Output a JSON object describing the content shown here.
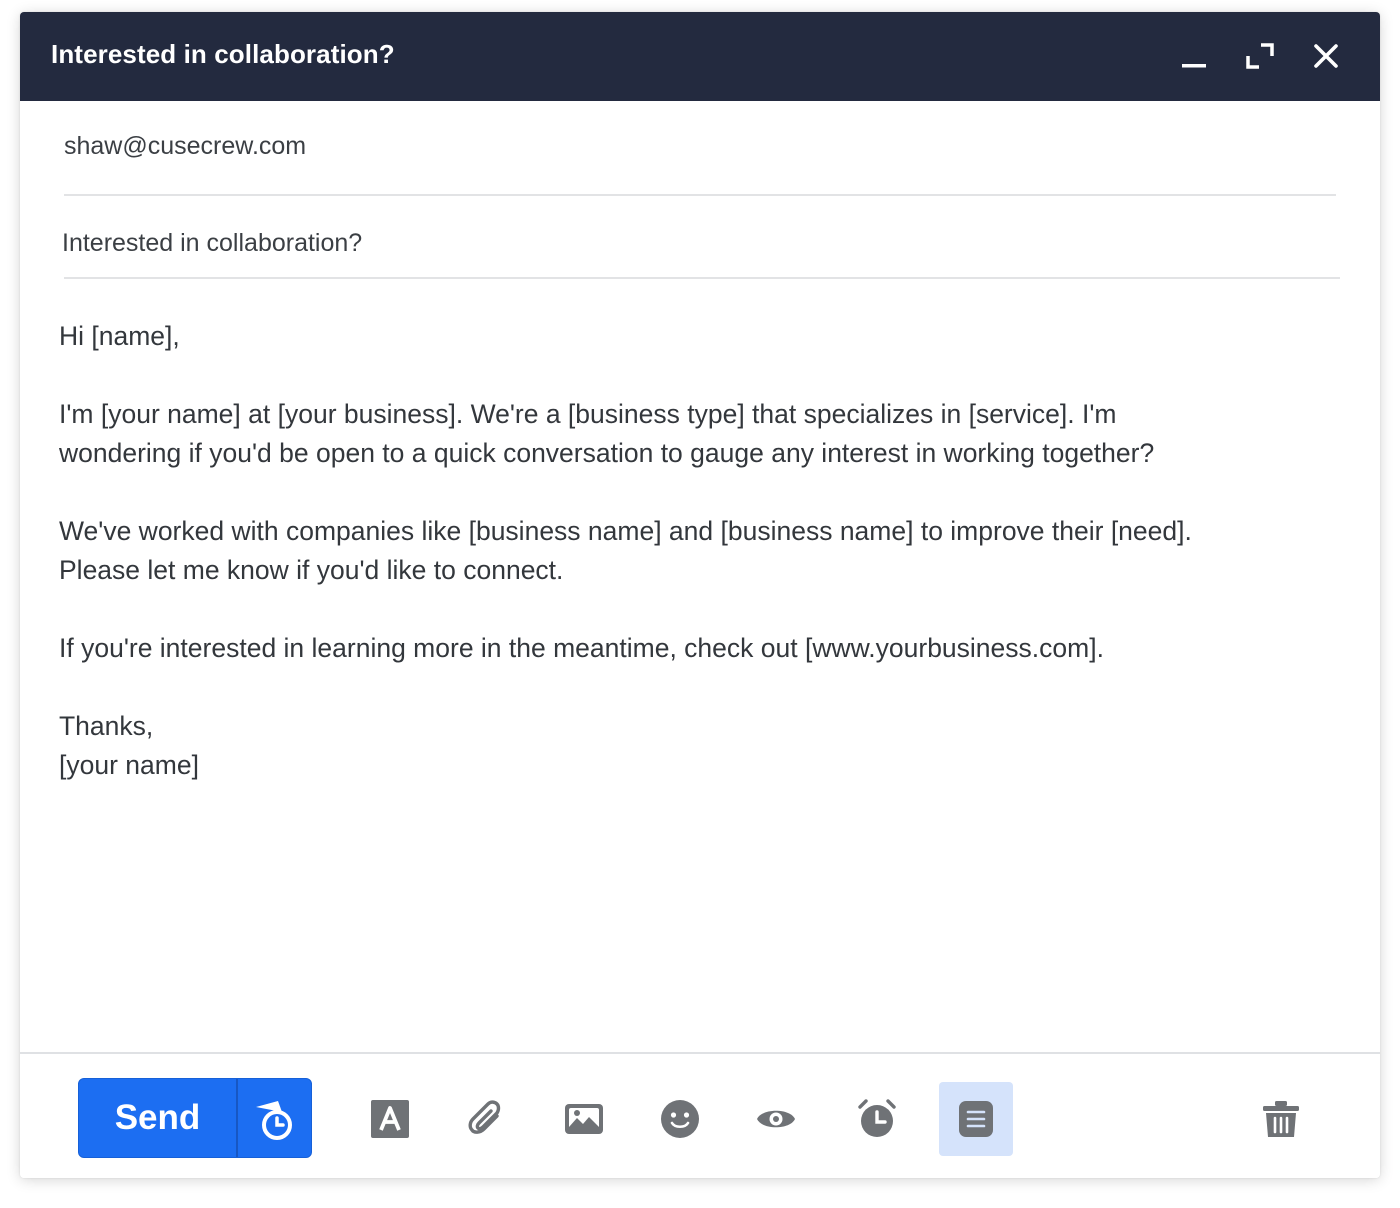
{
  "window": {
    "title": "Interested in collaboration?",
    "minimize_icon": "minimize-icon",
    "maximize_icon": "expand-icon",
    "close_icon": "close-icon"
  },
  "fields": {
    "to": "shaw@cusecrew.com",
    "subject": "Interested in collaboration?"
  },
  "body": {
    "greeting": "Hi [name],",
    "paragraph1_line1": "I'm [your name] at [your business]. We're a [business type] that specializes in [service]. I'm",
    "paragraph1_line2": "wondering if you'd be open to a quick conversation to gauge any interest in working together?",
    "paragraph2_line1": "We've worked with companies like [business name] and [business name] to improve their [need].",
    "paragraph2_line2": "Please let me know if you'd like to connect.",
    "paragraph3": "If you're interested in learning more in the meantime, check out [www.yourbusiness.com].",
    "signoff": "Thanks,",
    "signature": "[your name]"
  },
  "toolbar": {
    "send_label": "Send",
    "schedule_icon": "schedule-send-icon",
    "tools": [
      {
        "name": "formatting",
        "icon": "text-format-icon",
        "active": false
      },
      {
        "name": "attach",
        "icon": "paperclip-icon",
        "active": false
      },
      {
        "name": "image",
        "icon": "image-icon",
        "active": false
      },
      {
        "name": "emoji",
        "icon": "emoji-icon",
        "active": false
      },
      {
        "name": "tracking",
        "icon": "eye-icon",
        "active": false
      },
      {
        "name": "reminder",
        "icon": "alarm-clock-icon",
        "active": false
      },
      {
        "name": "templates",
        "icon": "template-icon",
        "active": true
      },
      {
        "name": "delete",
        "icon": "trash-icon",
        "active": false
      }
    ]
  },
  "colors": {
    "titlebar": "#232a3f",
    "send_button": "#1c6ef2",
    "active_tool_bg": "#d5e3fb",
    "icon_gray": "#6f7276"
  }
}
